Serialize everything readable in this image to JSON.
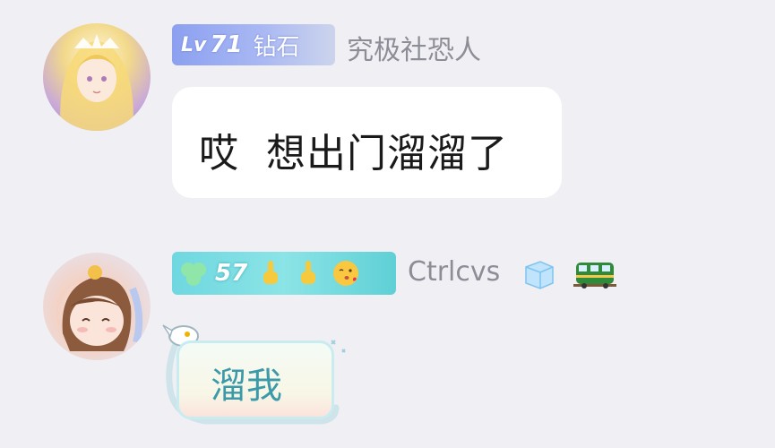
{
  "message1": {
    "level_prefix": "Lv",
    "level": "71",
    "rank": "钻石",
    "nickname": "究极社恐人",
    "text": "哎  想出门溜溜了"
  },
  "message2": {
    "level": "57",
    "nickname": "Ctrlcvs",
    "badge_icons": [
      "finger-pointing-up-icon",
      "finger-pointing-up-icon",
      "kissing-face-icon"
    ],
    "title_icons": [
      "ice-cube-icon",
      "train-icon"
    ],
    "text": "溜我"
  },
  "colors": {
    "background": "#f0f0f4",
    "nickname": "#8d8d97",
    "bubble": "#ffffff",
    "badge1": "#8ca0f0",
    "badge2": "#6fd7e0",
    "bubble2_text": "#3b9aa9"
  }
}
